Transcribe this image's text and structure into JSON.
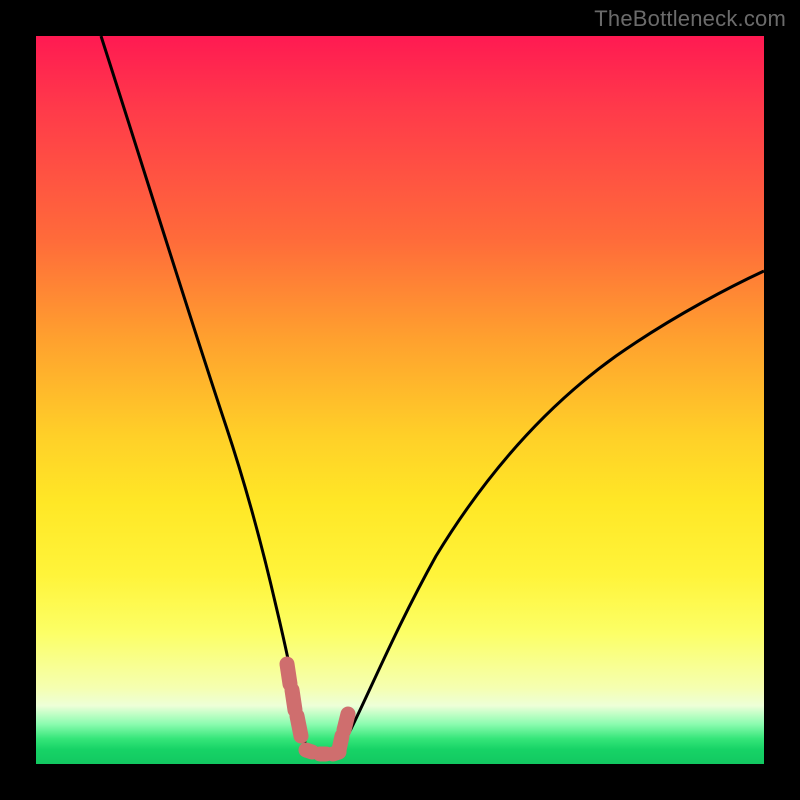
{
  "watermark": {
    "text": "TheBottleneck.com"
  },
  "colors": {
    "background": "#000000",
    "curve": "#000000",
    "marker": "#cf6e6e",
    "gradient_top": "#ff1a52",
    "gradient_bottom": "#12c861"
  },
  "chart_data": {
    "type": "line",
    "title": "",
    "xlabel": "",
    "ylabel": "",
    "xlim": [
      0,
      100
    ],
    "ylim": [
      0,
      100
    ],
    "grid": false,
    "series": [
      {
        "name": "left-curve",
        "x": [
          9,
          12,
          15,
          18,
          21,
          24,
          26,
          28,
          30,
          31.5,
          33,
          34.5,
          36,
          37
        ],
        "values": [
          100,
          86,
          74,
          63,
          53,
          43,
          35,
          27,
          19,
          13,
          8,
          4.5,
          2,
          1
        ]
      },
      {
        "name": "right-curve",
        "x": [
          41,
          43,
          46,
          50,
          55,
          61,
          68,
          76,
          85,
          94,
          100
        ],
        "values": [
          1,
          4,
          10,
          18,
          27,
          36,
          44,
          52,
          59,
          65,
          69
        ]
      },
      {
        "name": "valley-markers",
        "x": [
          34.5,
          35.3,
          36,
          37,
          38,
          39,
          40,
          41,
          41.7,
          42.3
        ],
        "values": [
          13,
          9,
          5.5,
          2.2,
          1.3,
          1.3,
          1.3,
          1.6,
          3.2,
          6.5
        ]
      }
    ],
    "legend": {
      "visible": false
    }
  }
}
